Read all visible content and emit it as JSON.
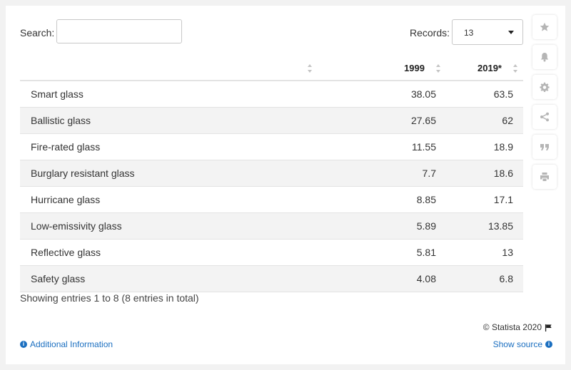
{
  "search": {
    "label": "Search:",
    "value": ""
  },
  "records": {
    "label": "Records:",
    "value": "13"
  },
  "table": {
    "headers": [
      "",
      "1999",
      "2019*"
    ],
    "rows": [
      {
        "name": "Smart glass",
        "v1999": "38.05",
        "v2019": "63.5"
      },
      {
        "name": "Ballistic glass",
        "v1999": "27.65",
        "v2019": "62"
      },
      {
        "name": "Fire-rated glass",
        "v1999": "11.55",
        "v2019": "18.9"
      },
      {
        "name": "Burglary resistant glass",
        "v1999": "7.7",
        "v2019": "18.6"
      },
      {
        "name": "Hurricane glass",
        "v1999": "8.85",
        "v2019": "17.1"
      },
      {
        "name": "Low-emissivity glass",
        "v1999": "5.89",
        "v2019": "13.85"
      },
      {
        "name": "Reflective glass",
        "v1999": "5.81",
        "v2019": "13"
      },
      {
        "name": "Safety glass",
        "v1999": "4.08",
        "v2019": "6.8"
      }
    ]
  },
  "footer": {
    "entries": "Showing entries 1 to 8 (8 entries in total)",
    "copyright": "© Statista 2020",
    "additional_info": "Additional Information",
    "show_source": "Show source"
  },
  "sidebar_icons": [
    "star-icon",
    "bell-icon",
    "gear-icon",
    "share-icon",
    "quote-icon",
    "print-icon"
  ],
  "colors": {
    "link": "#1b6fc0",
    "stripe": "#f3f3f3",
    "icon": "#b5b5b5"
  }
}
